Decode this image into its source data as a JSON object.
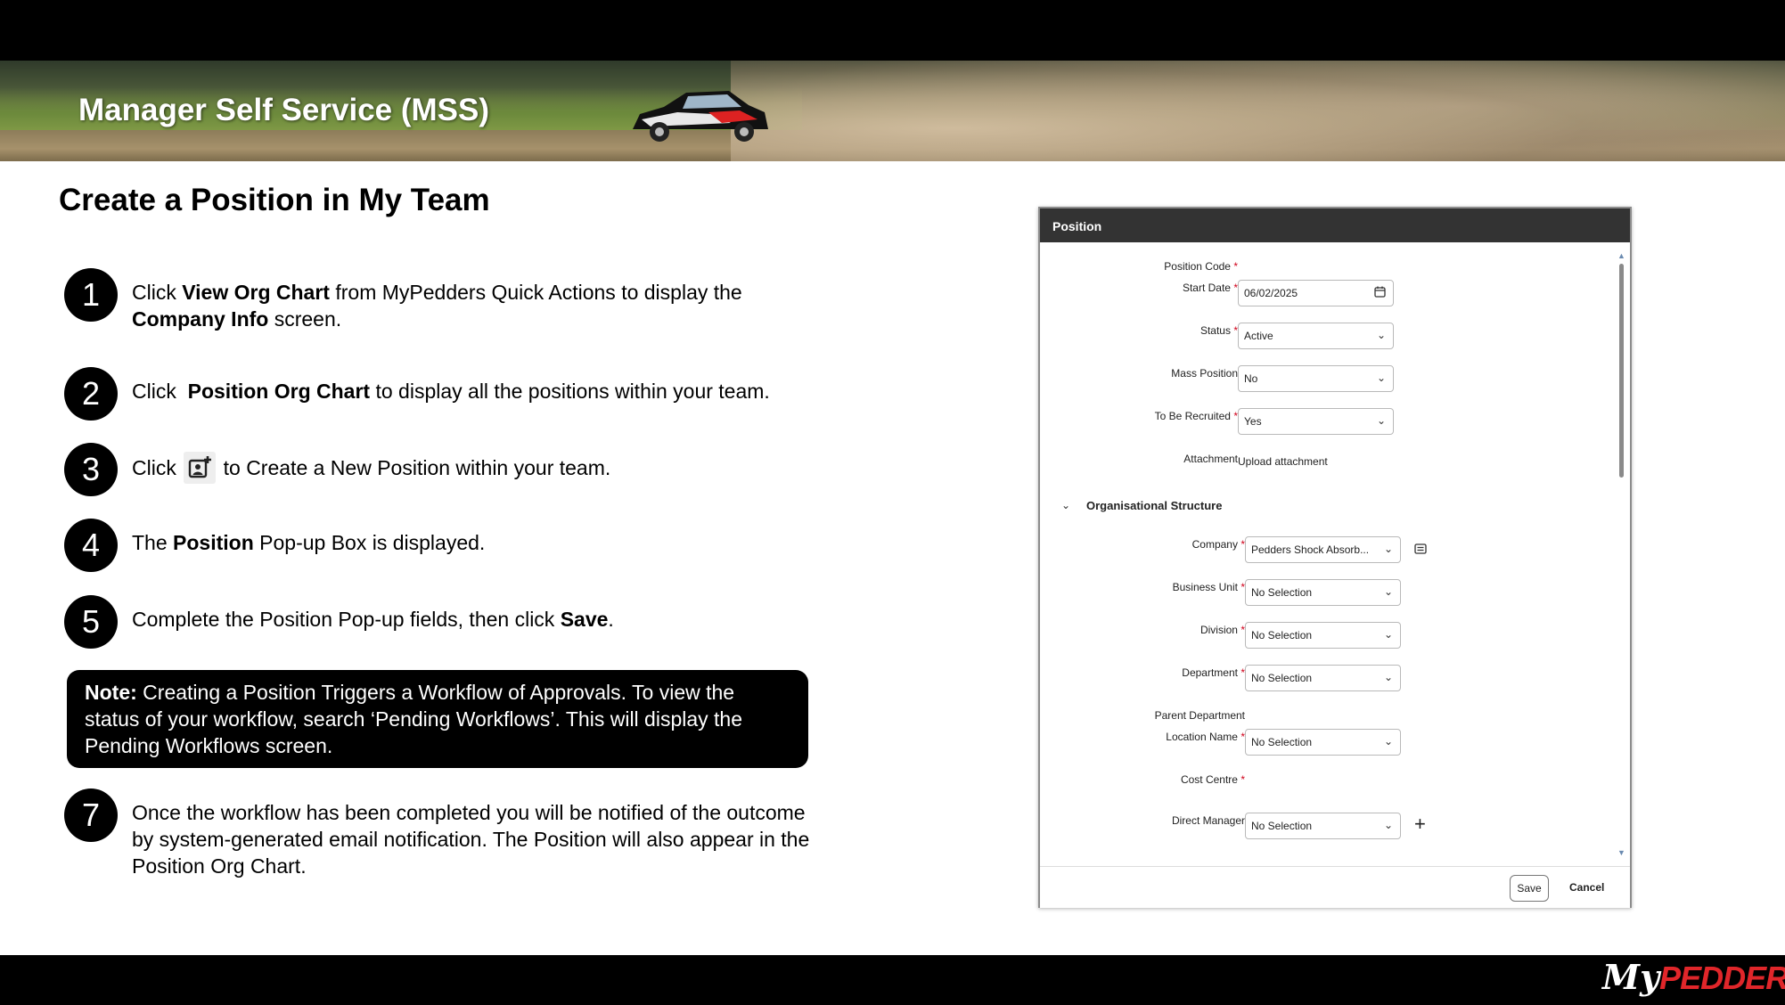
{
  "banner": {
    "title": "Manager Self Service (MSS)"
  },
  "page_title": "Create a Position in My Team",
  "steps": [
    {
      "num": "1",
      "parts": [
        "Click ",
        "View Org Chart",
        " from MyPedders Quick Actions to display the ",
        "Company Info",
        " screen."
      ]
    },
    {
      "num": "2",
      "parts": [
        "Click  ",
        "Position Org Chart",
        " to display all the positions within your team."
      ]
    },
    {
      "num": "3",
      "parts": [
        "Click ",
        " to Create a New Position within your team."
      ]
    },
    {
      "num": "4",
      "parts": [
        "The ",
        "Position",
        " Pop-up Box is displayed."
      ]
    },
    {
      "num": "5",
      "parts": [
        "Complete the Position Pop-up fields, then click ",
        "Save",
        "."
      ]
    },
    {
      "num": "7",
      "parts": [
        "Once the workflow has been completed you will be notified of the outcome by system-generated email notification. The Position will also appear in the Position Org Chart."
      ]
    }
  ],
  "note": {
    "label": "Note:",
    "text": " Creating a Position Triggers a Workflow of Approvals. To view the status of your workflow, search ‘Pending Workflows’. This will display the Pending Workflows screen."
  },
  "dialog": {
    "title": "Position",
    "fields": {
      "position_code": {
        "label": "Position Code"
      },
      "start_date": {
        "label": "Start Date",
        "value": "06/02/2025"
      },
      "status": {
        "label": "Status",
        "value": "Active"
      },
      "mass_position": {
        "label": "Mass Position",
        "value": "No"
      },
      "to_be_recruited": {
        "label": "To Be Recruited",
        "value": "Yes"
      },
      "attachment": {
        "label": "Attachment",
        "value": "Upload attachment"
      }
    },
    "org_section": {
      "title": "Organisational Structure",
      "company": {
        "label": "Company",
        "value": "Pedders Shock Absorb..."
      },
      "business_unit": {
        "label": "Business Unit",
        "value": "No Selection"
      },
      "division": {
        "label": "Division",
        "value": "No Selection"
      },
      "department": {
        "label": "Department",
        "value": "No Selection"
      },
      "parent_department": {
        "label": "Parent Department"
      },
      "location_name": {
        "label": "Location Name",
        "value": "No Selection"
      },
      "cost_centre": {
        "label": "Cost Centre"
      },
      "direct_manager": {
        "label": "Direct Manager",
        "value": "No Selection"
      }
    },
    "required_mark": "*",
    "save_label": "Save",
    "cancel_label": "Cancel"
  },
  "logo": {
    "prefix": "My",
    "brand": "PEDDERS"
  },
  "colors": {
    "accent_red": "#e0262a",
    "required_red": "#d0021b",
    "dialog_header": "#333333"
  },
  "icons": [
    "calendar-icon",
    "chevron-down-icon",
    "details-card-icon",
    "plus-icon",
    "add-position-icon"
  ]
}
